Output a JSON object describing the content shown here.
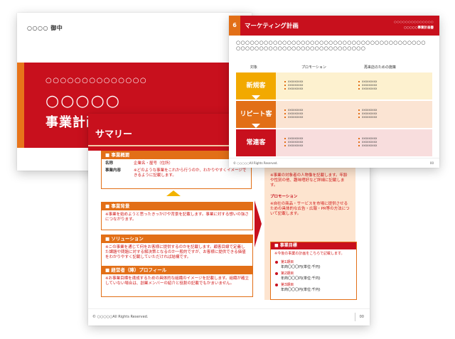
{
  "cover": {
    "to": "○○○○ 御中",
    "dots": "○○○○○○○○○○○○○○",
    "title_line1": "○○○○○",
    "title_line2": "事業計画書"
  },
  "summary": {
    "title": "サマリー",
    "overview": {
      "heading": "■ 事業概要",
      "name_key": "名称",
      "name_value": "企業名・屋号（住所）",
      "content_key": "事業内容",
      "content_value": "※どのような事業をこれから行うのか、わかりやすくイメージできるように記載します。"
    },
    "motive": {
      "heading": "■ 事業背景",
      "text": "※事業を始めようと思ったきっかけや背景を記載します。事業に対する想いの強さにつながります。"
    },
    "solution": {
      "heading": "■ ソリューション",
      "text": "※この事業を通じて何をお客様に提供するのかを記載します。顧客目線で定義した課題や問題に対する解決策となるのか一般的ですが、お客様に提供できる価値をわかりやすく記載していただければ結構です。"
    },
    "management": {
      "heading": "■ 経営者（陣）プロフィール",
      "text": "※お事業目標を達成するための具体的な組織のイメージを記載します。組織が確立していない場合は、創業メンバーの紹介と役割の記載でもかまいません。"
    },
    "right": {
      "target_text": "※事業の対象者の人物像を記載します。年齢や性別の他、趣味嗜好など詳細に記載します。",
      "promotion_label": "プロモーション",
      "promotion_text": "※自社の商品・サービスを市場に提供させるための具体的な広告・広報・PR等の方法について記載します。",
      "goal_heading": "■ 事業目標",
      "goal_intro": "※今後の事業の計画をこちらで記載します。",
      "goals": [
        {
          "label": "第1期目",
          "text": "年商〇〇〇円(単位:千円)"
        },
        {
          "label": "第2期目",
          "text": "年商〇〇〇円(単位:千円)"
        },
        {
          "label": "第3期目",
          "text": "年商〇〇〇円(単位:千円)"
        }
      ]
    },
    "copyright": "© ○○○○○All Rights Reserved.",
    "page": "00"
  },
  "marketing": {
    "number": "6",
    "title": "マーケティング計画",
    "corner_dots": "○○○○○○○○○○○○○○",
    "corner_sub": "○○○○○事業計画書",
    "description": "○○○○○○○○○○○○○○○○○○○○○○○○○○○○○○○○○○○○○○○○○○○○○○○○○○○○○○○○○○○○○○○○○○○○○",
    "headers": [
      "対象",
      "プロモーション",
      "再来店のための施策"
    ],
    "rows": [
      {
        "label": "新規客",
        "color": "#f2a900",
        "bg": "#fdf1cf",
        "items1": [
          "xxxxxxxxx",
          "xxxxxxxxx",
          "xxxxxxxxx"
        ],
        "items2": [
          "xxxxxxxxx",
          "xxxxxxxxx",
          "xxxxxxxxx"
        ]
      },
      {
        "label": "リピート客",
        "color": "#e26f17",
        "bg": "#fbe4d3",
        "items1": [
          "xxxxxxxxx",
          "xxxxxxxxx",
          "xxxxxxxxx"
        ],
        "items2": [
          "xxxxxxxxx",
          "xxxxxxxxx",
          "xxxxxxxxx"
        ]
      },
      {
        "label": "常連客",
        "color": "#c8101d",
        "bg": "#f8dddd",
        "items1": [
          "xxxxxxxxx",
          "xxxxxxxxx",
          "xxxxxxxxx"
        ],
        "items2": [
          "xxxxxxxxx",
          "xxxxxxxxx",
          "xxxxxxxxx"
        ]
      }
    ],
    "copyright": "© ○○○○○All Rights Reserved.",
    "page": "00"
  }
}
